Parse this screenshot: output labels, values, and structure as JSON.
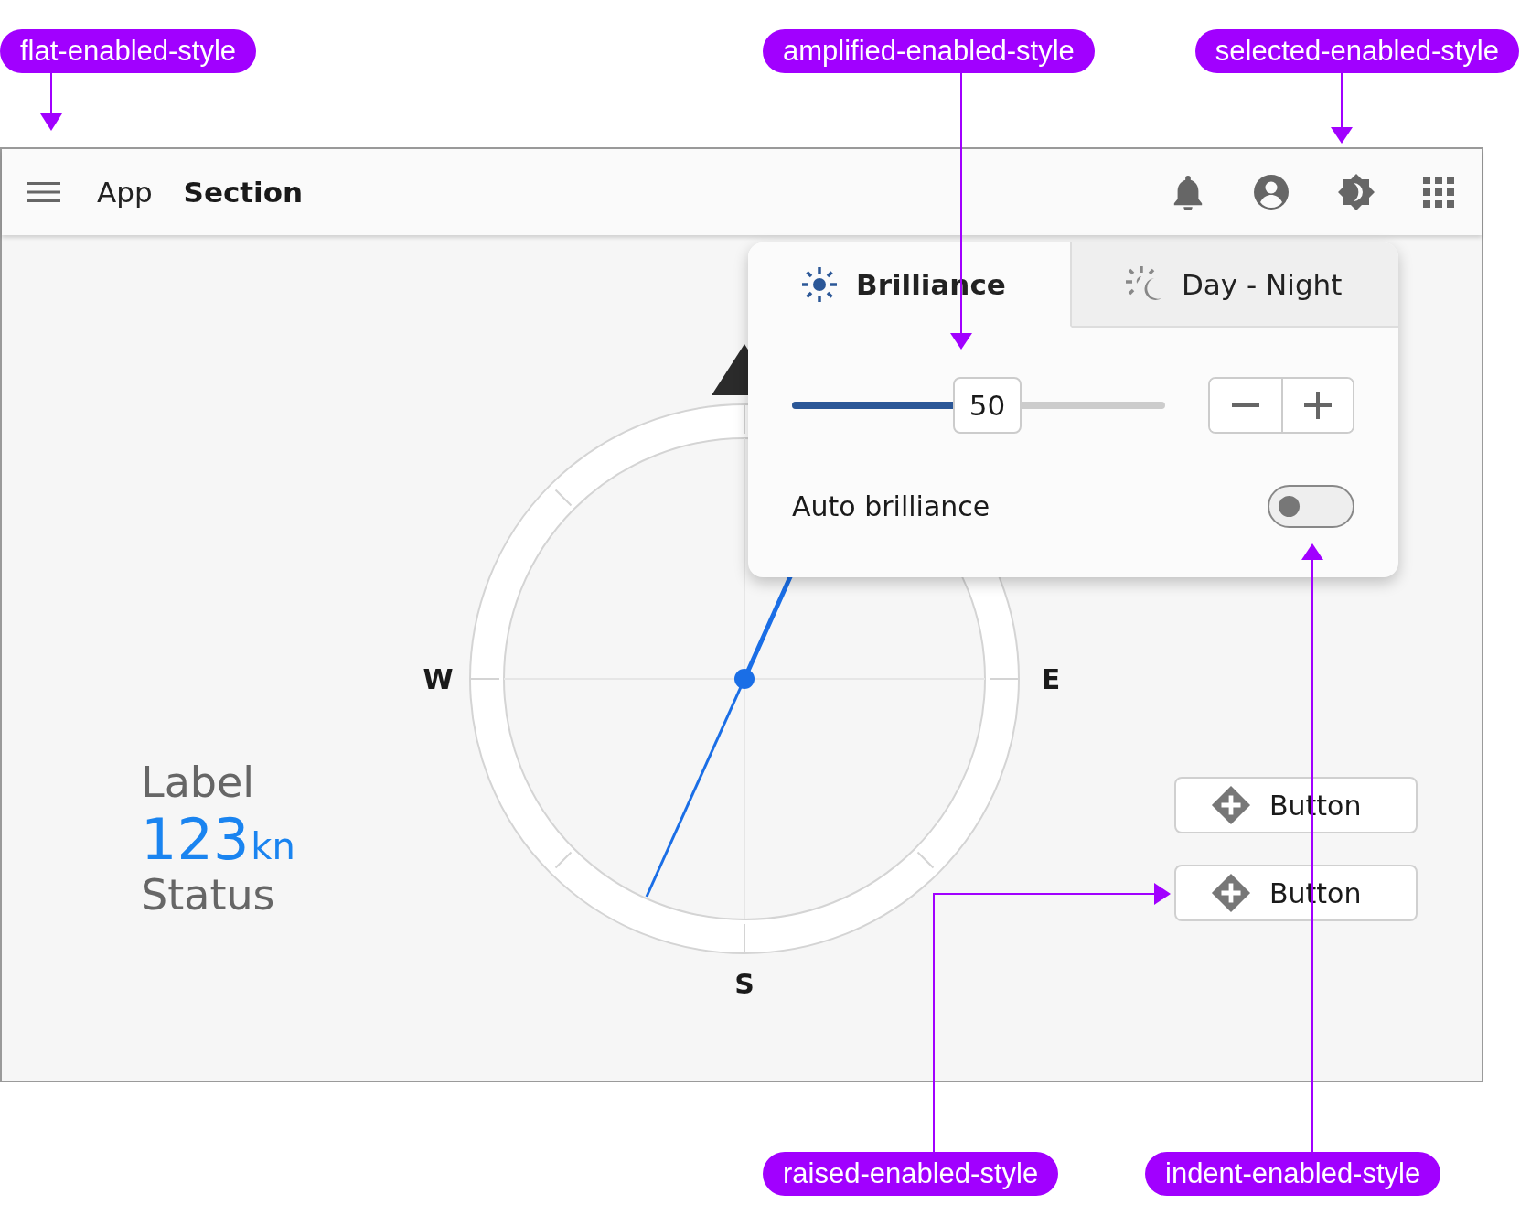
{
  "annotations": [
    {
      "text": "flat-enabled-style"
    },
    {
      "text": "amplified-enabled-style"
    },
    {
      "text": "selected-enabled-style"
    },
    {
      "text": "raised-enabled-style"
    },
    {
      "text": "indent-enabled-style"
    }
  ],
  "header": {
    "app": "App",
    "section": "Section"
  },
  "compass": {
    "directions": [
      "W",
      "E",
      "S"
    ]
  },
  "readout": {
    "label": "Label",
    "value": "123",
    "unit": "kn",
    "status": "Status"
  },
  "buttons": [
    {
      "label": "Button"
    },
    {
      "label": "Button"
    }
  ],
  "popup": {
    "tabs": [
      {
        "label": "Brilliance",
        "selected": true
      },
      {
        "label": "Day - Night",
        "selected": false
      }
    ],
    "slider": {
      "value": "50",
      "level": 0.48
    },
    "toggle": {
      "label": "Auto brilliance",
      "on": false
    }
  }
}
